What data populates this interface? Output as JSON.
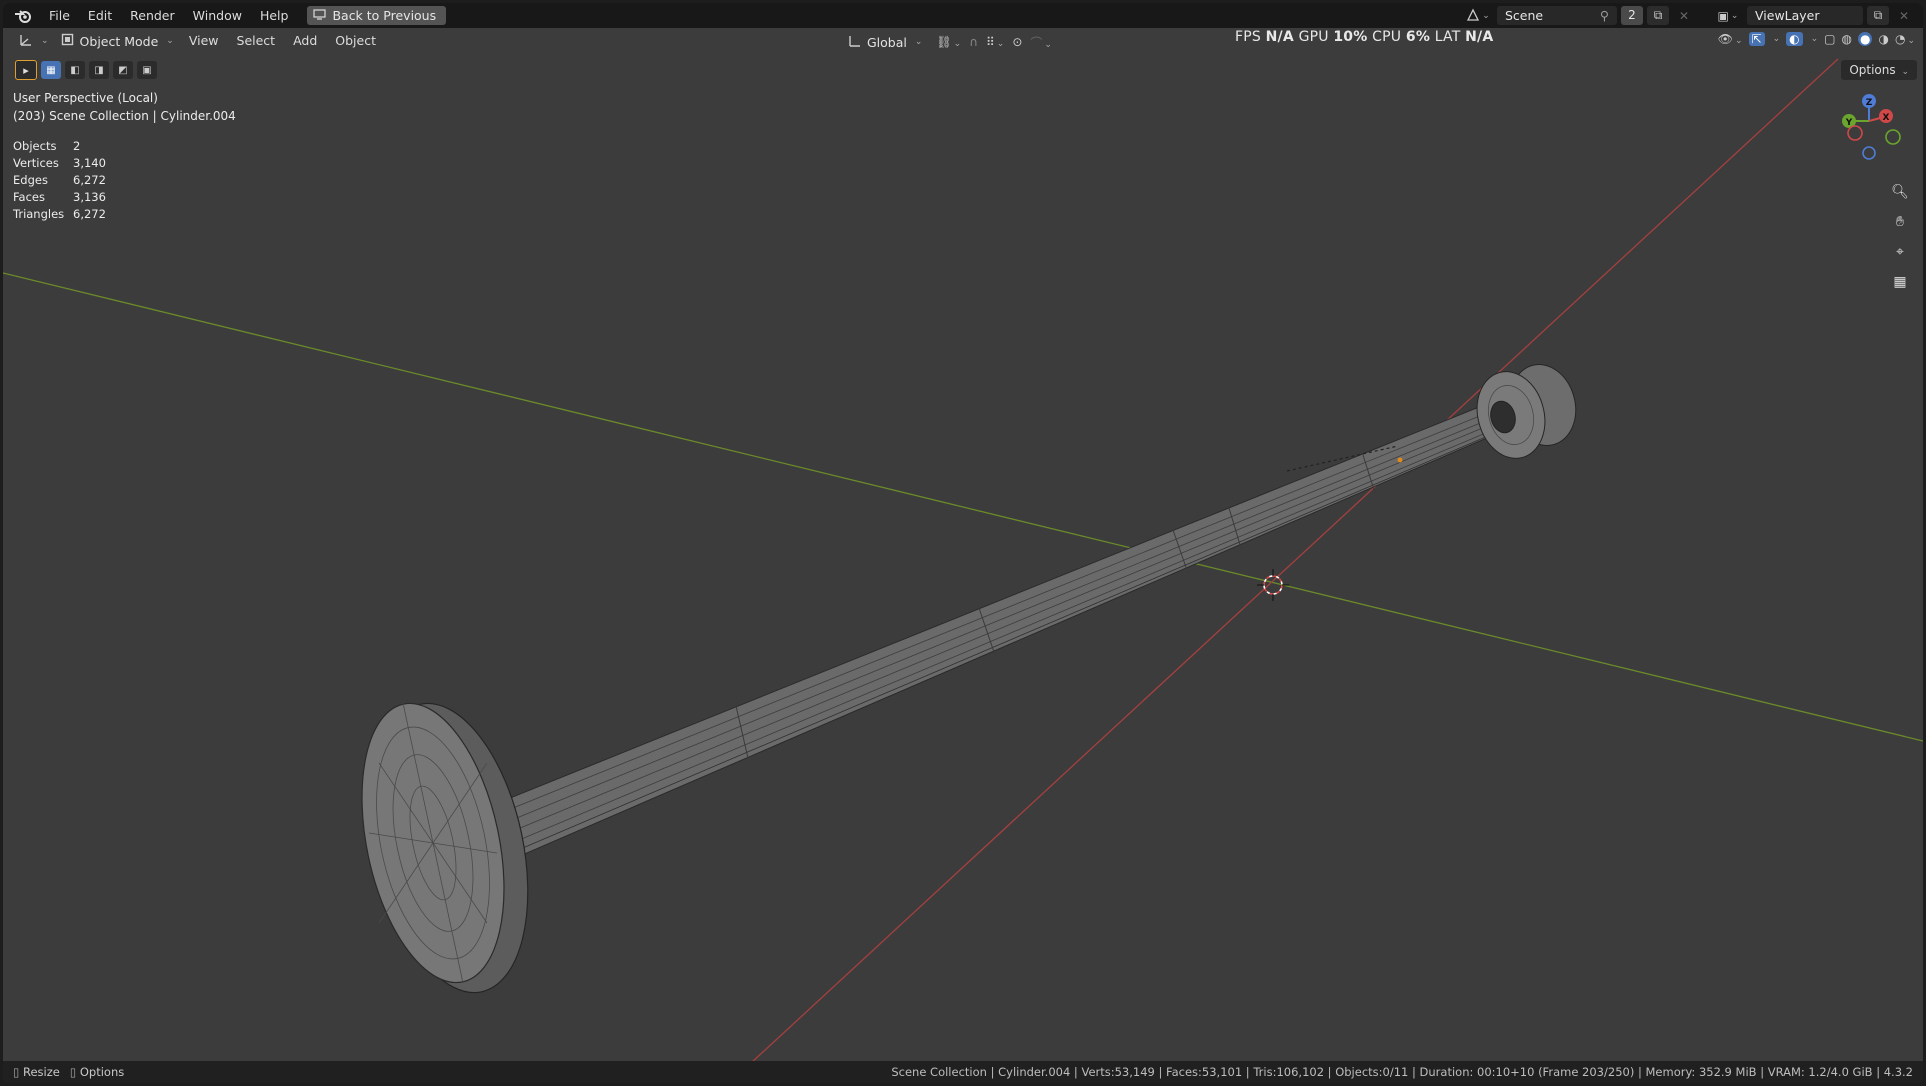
{
  "menus": [
    "File",
    "Edit",
    "Render",
    "Window",
    "Help"
  ],
  "back_button": "Back to Previous",
  "scene": {
    "name": "Scene",
    "count": "2"
  },
  "view_layer": "ViewLayer",
  "header": {
    "mode": "Object Mode",
    "items": [
      "View",
      "Select",
      "Add",
      "Object"
    ],
    "orientation": "Global",
    "options": "Options"
  },
  "perf": {
    "fps_label": "FPS",
    "fps": "N/A",
    "gpu_label": "GPU",
    "gpu": "10%",
    "cpu_label": "CPU",
    "cpu": "6%",
    "lat_label": "LAT",
    "lat": "N/A"
  },
  "overlay": {
    "view_name": "User Perspective (Local)",
    "collection": "(203) Scene Collection | Cylinder.004"
  },
  "stats": [
    {
      "label": "Objects",
      "value": "2"
    },
    {
      "label": "Vertices",
      "value": "3,140"
    },
    {
      "label": "Edges",
      "value": "6,272"
    },
    {
      "label": "Faces",
      "value": "3,136"
    },
    {
      "label": "Triangles",
      "value": "6,272"
    }
  ],
  "gizmo": {
    "z": "Z",
    "y": "Y",
    "x": "X"
  },
  "status": {
    "left": [
      "Resize",
      "Options"
    ],
    "right": "Scene Collection | Cylinder.004 | Verts:53,149 | Faces:53,101 | Tris:106,102 | Objects:0/11 | Duration: 00:10+10 (Frame 203/250) | Memory: 352.9 MiB | VRAM: 1.2/4.0 GiB | 4.3.2"
  },
  "colors": {
    "x_axis": "#b0403e",
    "y_axis": "#6a8c2a",
    "accent": "#4772b3",
    "viewport_bg": "#3c3c3c"
  }
}
